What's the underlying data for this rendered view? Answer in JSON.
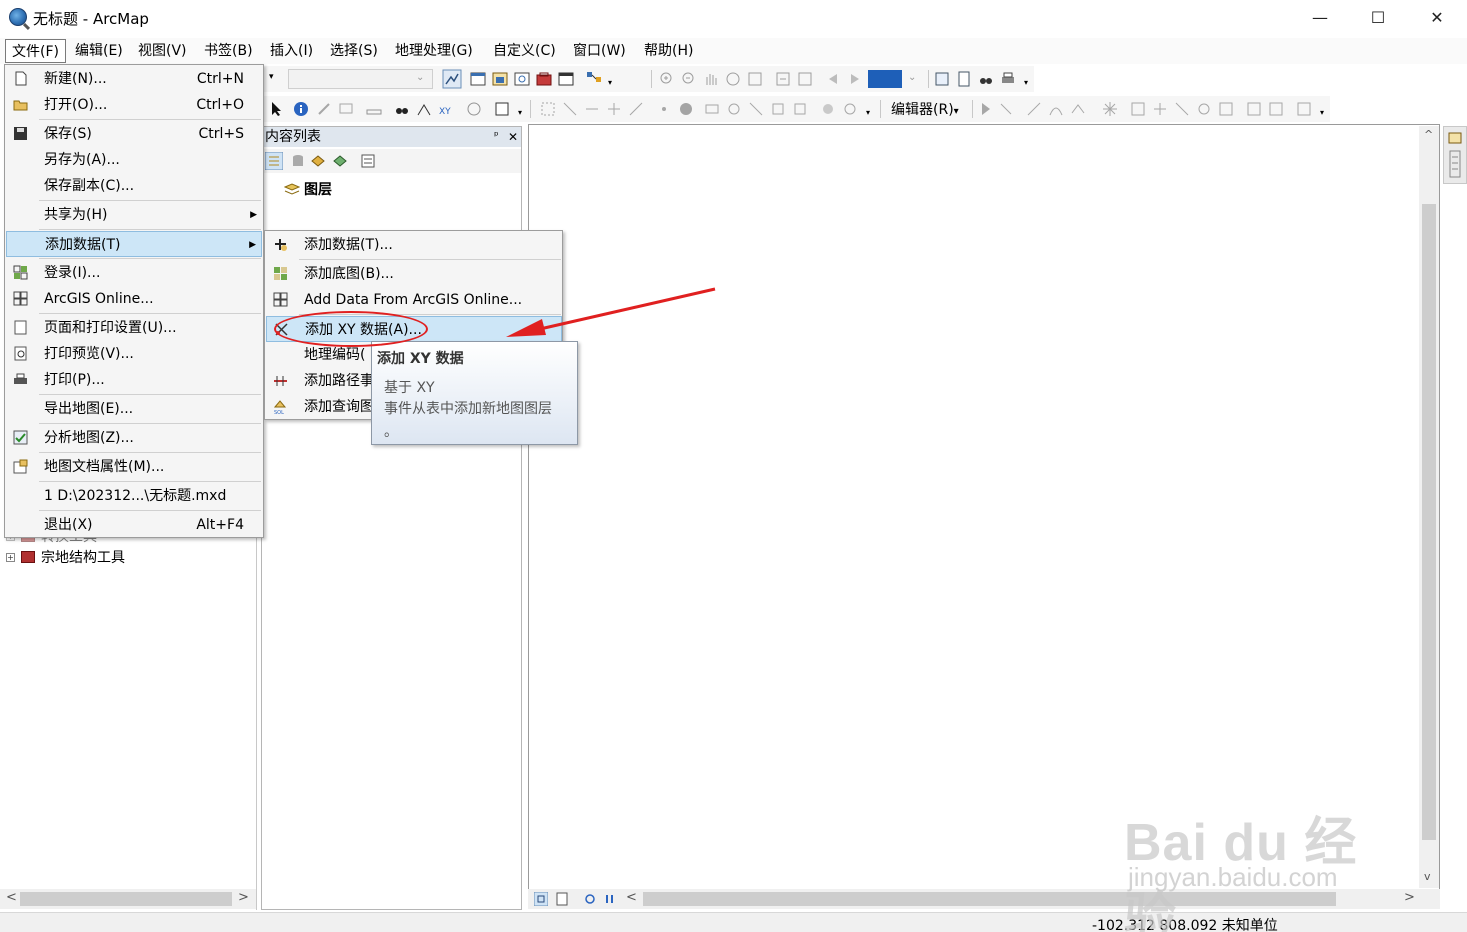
{
  "window": {
    "title": "无标题 - ArcMap",
    "minimize": "—",
    "maximize": "☐",
    "close": "✕"
  },
  "menubar": {
    "items": [
      "文件(F)",
      "编辑(E)",
      "视图(V)",
      "书签(B)",
      "插入(I)",
      "选择(S)",
      "地理处理(G)",
      "自定义(C)",
      "窗口(W)",
      "帮助(H)"
    ]
  },
  "toolbar": {
    "editor_label": "编辑器(R)",
    "editor_arrow": "▾"
  },
  "file_menu": {
    "items": [
      {
        "label": "新建(N)...",
        "shortcut": "Ctrl+N",
        "icon": "new-document-icon"
      },
      {
        "label": "打开(O)...",
        "shortcut": "Ctrl+O",
        "icon": "open-folder-icon"
      },
      {
        "label": "保存(S)",
        "shortcut": "Ctrl+S",
        "icon": "save-disk-icon"
      },
      {
        "label": "另存为(A)...",
        "shortcut": ""
      },
      {
        "label": "保存副本(C)...",
        "shortcut": ""
      },
      {
        "label": "共享为(H)",
        "shortcut": "",
        "submenu": true
      },
      {
        "label": "添加数据(T)",
        "shortcut": "",
        "submenu": true,
        "highlighted": true
      },
      {
        "label": "登录(I)...",
        "shortcut": "",
        "icon": "grid-icon"
      },
      {
        "label": "ArcGIS Online...",
        "shortcut": "",
        "icon": "grid-icon"
      },
      {
        "label": "页面和打印设置(U)...",
        "shortcut": "",
        "icon": "page-setup-icon"
      },
      {
        "label": "打印预览(V)...",
        "shortcut": "",
        "icon": "print-preview-icon"
      },
      {
        "label": "打印(P)...",
        "shortcut": "",
        "icon": "printer-icon"
      },
      {
        "label": "导出地图(E)...",
        "shortcut": ""
      },
      {
        "label": "分析地图(Z)...",
        "shortcut": "",
        "icon": "analyze-check-icon"
      },
      {
        "label": "地图文档属性(M)...",
        "shortcut": "",
        "icon": "document-properties-icon"
      },
      {
        "label": "1 D:\\202312...\\无标题.mxd",
        "shortcut": ""
      },
      {
        "label": "退出(X)",
        "shortcut": "Alt+F4"
      }
    ]
  },
  "add_data_submenu": {
    "items": [
      {
        "label": "添加数据(T)...",
        "icon": "add-data-plus-icon"
      },
      {
        "label": "添加底图(B)...",
        "icon": "basemap-grid-icon"
      },
      {
        "label": "Add Data From ArcGIS Online...",
        "icon": "grid-icon"
      },
      {
        "label": "添加 XY 数据(A)...",
        "icon": "xy-data-icon",
        "highlighted": true
      },
      {
        "label": "地理编码(",
        "icon": ""
      },
      {
        "label": "添加路径事",
        "icon": "route-event-icon"
      },
      {
        "label": "添加查询图",
        "icon": "sql-query-icon"
      }
    ]
  },
  "tooltip": {
    "title": "添加 XY 数据",
    "line1": "基于 XY",
    "line2": "事件从表中添加新地图图层",
    "line3": "。"
  },
  "toc": {
    "title": "内容列表",
    "pin": "ᵖ",
    "close": "✕",
    "layers_label": "图层"
  },
  "catalog": {
    "row_partial": "转换工具",
    "row_parcel": "宗地结构工具"
  },
  "scroll": {
    "left": "<",
    "right": ">",
    "up": "^",
    "down": "v"
  },
  "status": {
    "coordinates": "-102.312  808.092 未知单位"
  },
  "watermark": {
    "brand": "Bai du 经验",
    "url": "jingyan.baidu.com"
  },
  "colors": {
    "highlight": "#cde6f7",
    "annotation_red": "#e02020",
    "toc_header": "#dfe6ee"
  }
}
